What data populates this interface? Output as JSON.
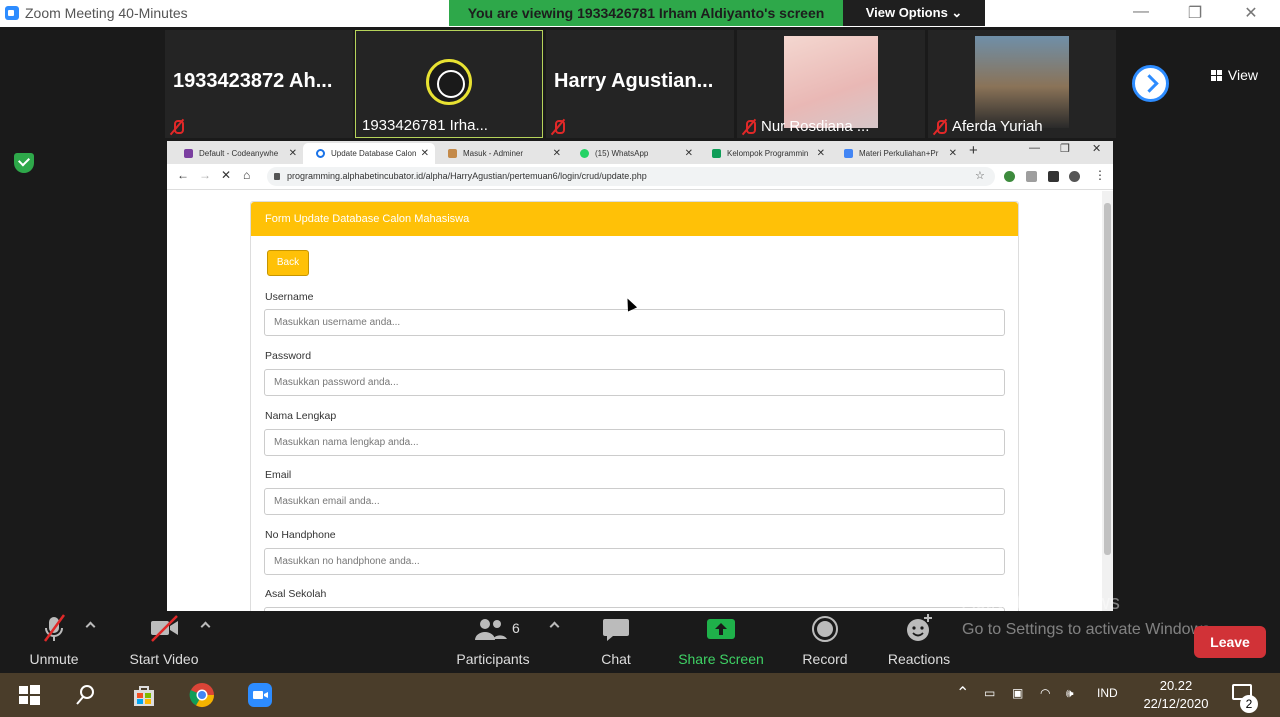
{
  "zoom_window": {
    "title": "Zoom Meeting 40-Minutes",
    "viewing_banner": "You are viewing 1933426781 Irham Aldiyanto's screen",
    "view_options": "View Options ⌄",
    "view_label": "View"
  },
  "participants": [
    {
      "name": "1933423872  Ah...",
      "muted": true
    },
    {
      "name": "1933426781 Irha...",
      "muted": false,
      "active": true
    },
    {
      "name": "Harry  Agustian...",
      "muted": true
    },
    {
      "name": "Nur Rosdiana ...",
      "muted": true
    },
    {
      "name": "Aferda Yuriah",
      "muted": true
    }
  ],
  "browser": {
    "tabs": [
      {
        "label": "Default - Codeanywhe",
        "color": "#7b3fa0"
      },
      {
        "label": "Update Database Calon",
        "color": "#1a73e8",
        "selected": true
      },
      {
        "label": "Masuk - Adminer",
        "color": "#c48a4a"
      },
      {
        "label": "(15) WhatsApp",
        "color": "#25d366"
      },
      {
        "label": "Kelompok Programmin",
        "color": "#0f9d58"
      },
      {
        "label": "Materi Perkuliahan+Pr",
        "color": "#4285f4"
      }
    ],
    "url": "programming.alphabetincubator.id/alpha/HarryAgustian/pertemuan6/login/crud/update.php"
  },
  "form": {
    "header": "Form Update Database Calon Mahasiswa",
    "back_label": "Back",
    "fields": [
      {
        "label": "Username",
        "placeholder": "Masukkan username anda..."
      },
      {
        "label": "Password",
        "placeholder": "Masukkan password anda..."
      },
      {
        "label": "Nama Lengkap",
        "placeholder": "Masukkan nama lengkap anda..."
      },
      {
        "label": "Email",
        "placeholder": "Masukkan email anda..."
      },
      {
        "label": "No Handphone",
        "placeholder": "Masukkan no handphone anda..."
      },
      {
        "label": "Asal Sekolah",
        "placeholder": ""
      }
    ]
  },
  "toolbar": {
    "unmute": "Unmute",
    "start_video": "Start Video",
    "participants": "Participants",
    "participants_count": "6",
    "chat": "Chat",
    "share_screen": "Share Screen",
    "record": "Record",
    "reactions": "Reactions",
    "leave": "Leave"
  },
  "watermark": {
    "line1": "Activate Windows",
    "line2": "Go to Settings to activate Windows."
  },
  "taskbar": {
    "language": "IND",
    "time": "20.22",
    "date": "22/12/2020",
    "notification_count": "2"
  },
  "colors": {
    "zoom_green": "#2ea84a",
    "zoom_blue": "#2d8cff",
    "leave_red": "#d13237",
    "form_header": "#ffc107"
  }
}
